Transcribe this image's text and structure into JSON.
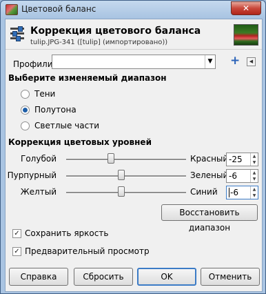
{
  "window": {
    "title": "Цветовой баланс",
    "close_glyph": "✕"
  },
  "header": {
    "title": "Коррекция цветового баланса",
    "subtitle": "tulip.JPG-341 ([tulip] (импортировано))"
  },
  "profiles": {
    "label": "Профили:",
    "value": ""
  },
  "range": {
    "heading": "Выберите изменяемый диапазон",
    "options": [
      {
        "label": "Тени",
        "selected": false
      },
      {
        "label": "Полутона",
        "selected": true
      },
      {
        "label": "Светлые части",
        "selected": false
      }
    ]
  },
  "levels": {
    "heading": "Коррекция цветовых уровней",
    "rows": [
      {
        "left": "Голубой",
        "right": "Красный",
        "value": "-25",
        "level": -25
      },
      {
        "left": "Пурпурный",
        "right": "Зеленый",
        "value": "-6",
        "level": -6
      },
      {
        "left": "Желтый",
        "right": "Синий",
        "value": "-6",
        "level": -6
      }
    ],
    "reset_label": "Восстановить диапазон"
  },
  "options": {
    "preserve_luminosity": {
      "label": "Сохранить яркость",
      "checked": true
    },
    "preview": {
      "label": "Предварительный просмотр",
      "checked": true
    }
  },
  "buttons": {
    "help": "Справка",
    "reset": "Сбросить",
    "ok": "OK",
    "cancel": "Отменить"
  }
}
